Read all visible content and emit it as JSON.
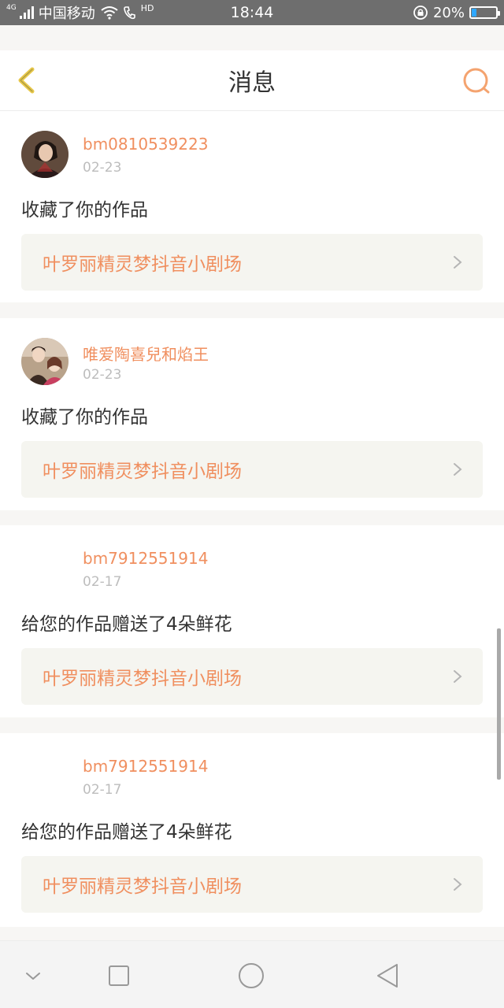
{
  "status_bar": {
    "network_type": "4G",
    "carrier": "中国移动",
    "hd_label": "HD",
    "time": "18:44",
    "battery": "20%",
    "battery_level": 0.2
  },
  "header": {
    "title": "消息"
  },
  "messages": [
    {
      "username": "bm0810539223",
      "date": "02-23",
      "action": "收藏了你的作品",
      "work_title": "叶罗丽精灵梦抖音小剧场",
      "has_avatar": true
    },
    {
      "username": "唯爱陶喜兒和焰王",
      "date": "02-23",
      "action": "收藏了你的作品",
      "work_title": "叶罗丽精灵梦抖音小剧场",
      "has_avatar": true
    },
    {
      "username": "bm7912551914",
      "date": "02-17",
      "action": "给您的作品赠送了4朵鲜花",
      "work_title": "叶罗丽精灵梦抖音小剧场",
      "has_avatar": false
    },
    {
      "username": "bm7912551914",
      "date": "02-17",
      "action": "给您的作品赠送了4朵鲜花",
      "work_title": "叶罗丽精灵梦抖音小剧场",
      "has_avatar": false
    }
  ],
  "colors": {
    "accent": "#f08f5f",
    "back_arrow": "#e8c84a",
    "status_bar": "#6e6e6e"
  },
  "icons": {
    "back": "back-arrow-icon",
    "search": "search-icon",
    "chevron": "chevron-right-icon",
    "nav_hide": "chevron-down-icon",
    "nav_recents": "square-icon",
    "nav_home": "circle-icon",
    "nav_back": "triangle-back-icon"
  }
}
